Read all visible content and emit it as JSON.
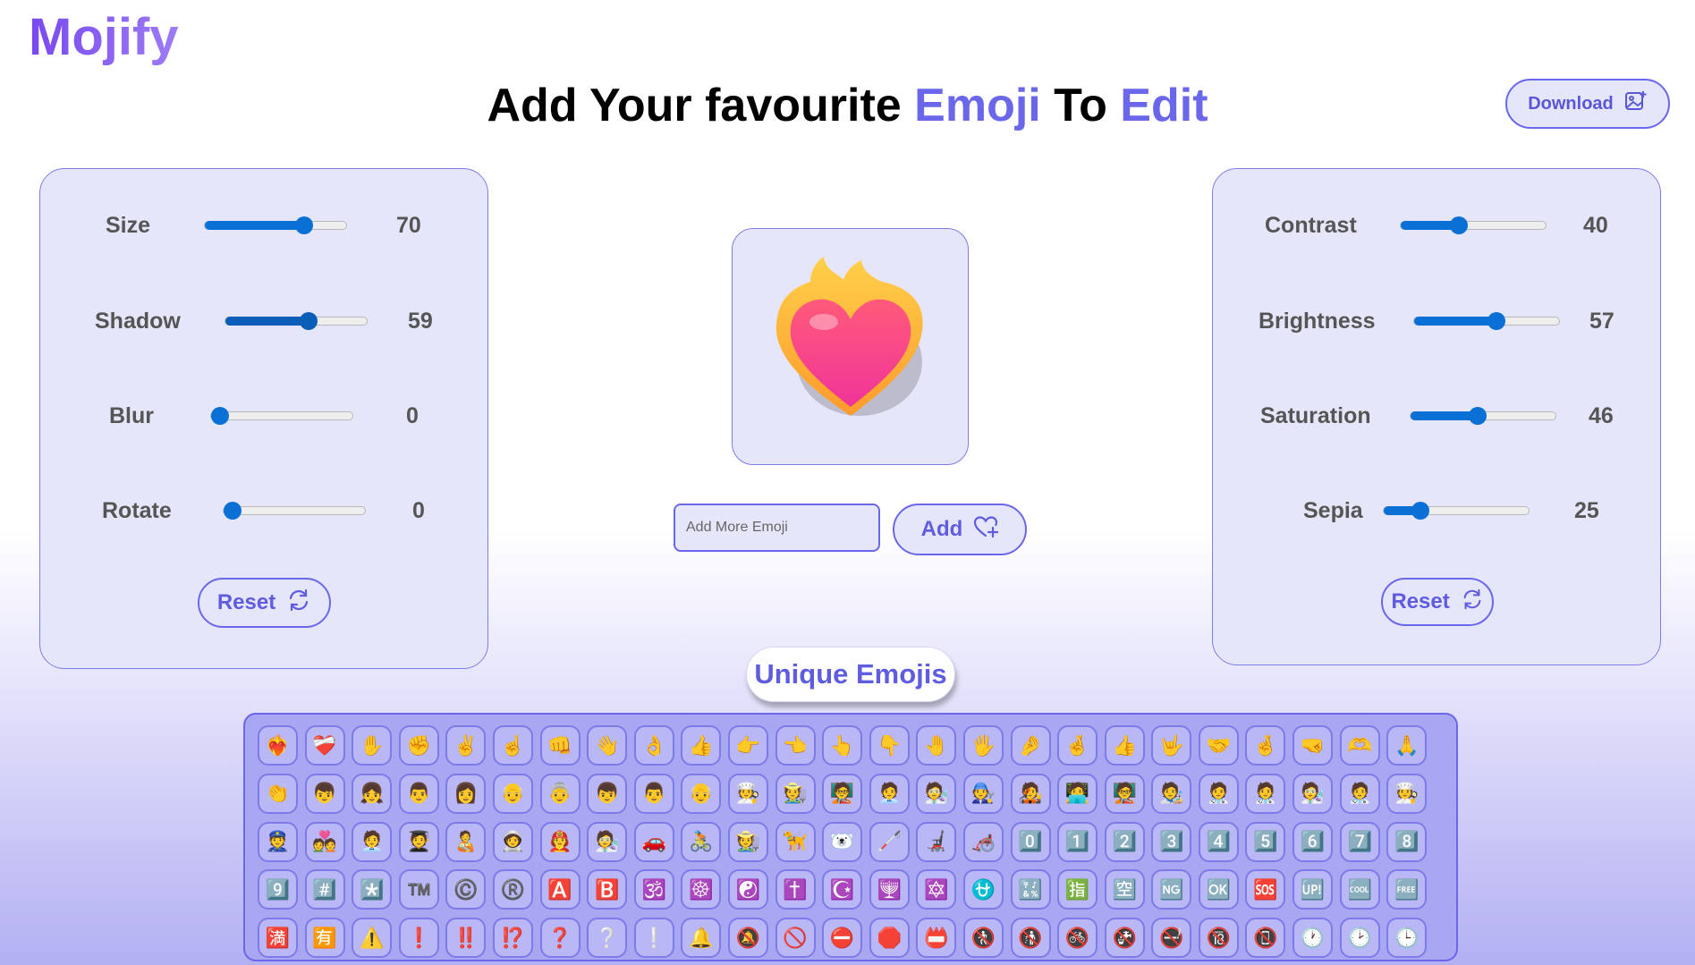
{
  "app": {
    "logo": "Mojify"
  },
  "header": {
    "part1": "Add Your favourite ",
    "part2": "Emoji",
    "part3": " To ",
    "part4": "Edit",
    "accent_color": "#6a67ea"
  },
  "download": {
    "label": "Download",
    "icon": "image-plus-icon"
  },
  "left_panel": {
    "controls": [
      {
        "label": "Size",
        "value": "70",
        "fraction": 0.7
      },
      {
        "label": "Shadow",
        "value": "59",
        "fraction": 0.59
      },
      {
        "label": "Blur",
        "value": "0",
        "fraction": 0.0
      },
      {
        "label": "Rotate",
        "value": "0",
        "fraction": 0.0
      }
    ],
    "reset_label": "Reset"
  },
  "right_panel": {
    "controls": [
      {
        "label": "Contrast",
        "value": "40",
        "fraction": 0.4
      },
      {
        "label": "Brightness",
        "value": "57",
        "fraction": 0.57
      },
      {
        "label": "Saturation",
        "value": "46",
        "fraction": 0.46
      },
      {
        "label": "Sepia",
        "value": "25",
        "fraction": 0.25
      }
    ],
    "reset_label": "Reset"
  },
  "preview": {
    "emoji": "heart-on-fire"
  },
  "add_form": {
    "placeholder": "Add More Emoji",
    "button_label": "Add",
    "button_icon": "heart-plus-icon"
  },
  "unique": {
    "title": "Unique Emojis"
  },
  "emoji_grid": [
    "❤️‍🔥",
    "❤️‍🩹",
    "✋",
    "✊",
    "✌️",
    "☝️",
    "👊",
    "👋",
    "👌",
    "👍",
    "👉",
    "👈",
    "👆",
    "👇",
    "🤚",
    "🖐️",
    "🤌",
    "🤞",
    "👍",
    "🤟",
    "🤝",
    "🤞",
    "🤜",
    "🫶",
    "🙏",
    "👏",
    "👦",
    "👧",
    "👨",
    "👩",
    "👴",
    "👵",
    "👦",
    "👨",
    "👴",
    "🧑‍🍳",
    "🧑‍🌾",
    "🧑‍🏫",
    "🧑‍💼",
    "🧑‍🔬",
    "🧑‍🔧",
    "🧑‍🎤",
    "🧑‍💻",
    "🧑‍🏫",
    "🧑‍🎨",
    "🧑‍⚕️",
    "🧑‍⚕️",
    "🧑‍🔬",
    "🧑‍⚕️",
    "🧑‍🍳",
    "👮",
    "💑",
    "🧑‍💼",
    "🧑‍🎓",
    "🧑‍🍼",
    "🧑‍🚀",
    "🧑‍🚒",
    "🧑‍🔬",
    "🚗",
    "🚴",
    "🧑‍🌾",
    "🦮",
    "🐻‍❄️",
    "🦯",
    "🦼",
    "🦽",
    "0️⃣",
    "1️⃣",
    "2️⃣",
    "3️⃣",
    "4️⃣",
    "5️⃣",
    "6️⃣",
    "7️⃣",
    "8️⃣",
    "9️⃣",
    "#️⃣",
    "*️⃣",
    "™️",
    "©️",
    "®️",
    "🅰️",
    "🅱️",
    "🕉️",
    "☸️",
    "☯️",
    "✝️",
    "☪️",
    "🕎",
    "🔯",
    "⛎",
    "🔣",
    "🈯",
    "🈳",
    "🆖",
    "🆗",
    "🆘",
    "🆙",
    "🆒",
    "🆓",
    "🈵",
    "🈶",
    "⚠️",
    "❗",
    "‼️",
    "⁉️",
    "❓",
    "❔",
    "❕",
    "🔔",
    "🔕",
    "🚫",
    "⛔",
    "🛑",
    "📛",
    "🚷",
    "🚯",
    "🚳",
    "🚱",
    "🚭",
    "🔞",
    "📵",
    "🕐",
    "🕑",
    "🕒"
  ]
}
